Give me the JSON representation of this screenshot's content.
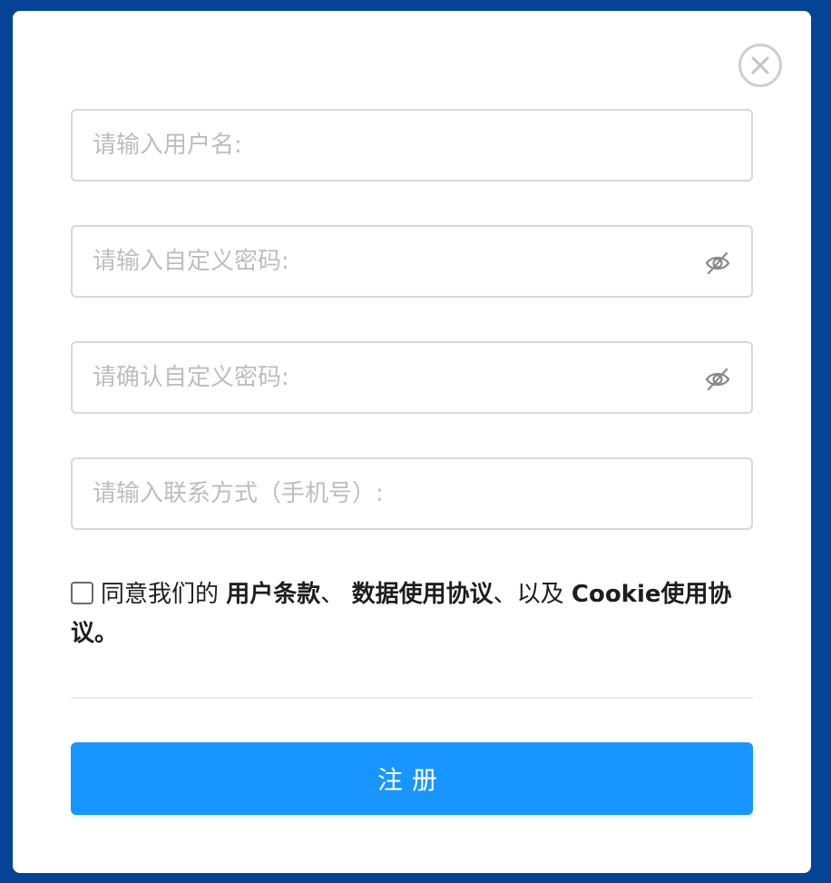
{
  "colors": {
    "backdrop": "#044396",
    "modal_background": "#ffffff",
    "accent": "#1995ff",
    "border": "#d8d8d8",
    "placeholder": "#bdbdbd",
    "text": "#1e1e1e"
  },
  "dialog": {
    "close_icon": "close-icon"
  },
  "form": {
    "username": {
      "placeholder": "请输入用户名:",
      "value": ""
    },
    "password": {
      "placeholder": "请输入自定义密码:",
      "value": "",
      "toggle_icon": "eye-off-icon"
    },
    "confirm_password": {
      "placeholder": "请确认自定义密码:",
      "value": "",
      "toggle_icon": "eye-off-icon"
    },
    "phone": {
      "placeholder": "请输入联系方式（手机号）:",
      "value": ""
    }
  },
  "agreement": {
    "checked": false,
    "prefix": "同意我们的",
    "terms_link": "用户条款",
    "sep1": "、",
    "data_policy_link": "数据使用协议",
    "sep2": "、以及",
    "cookie_policy_link": "Cookie使用协议",
    "suffix": "。"
  },
  "submit_button": {
    "label": "注册"
  }
}
